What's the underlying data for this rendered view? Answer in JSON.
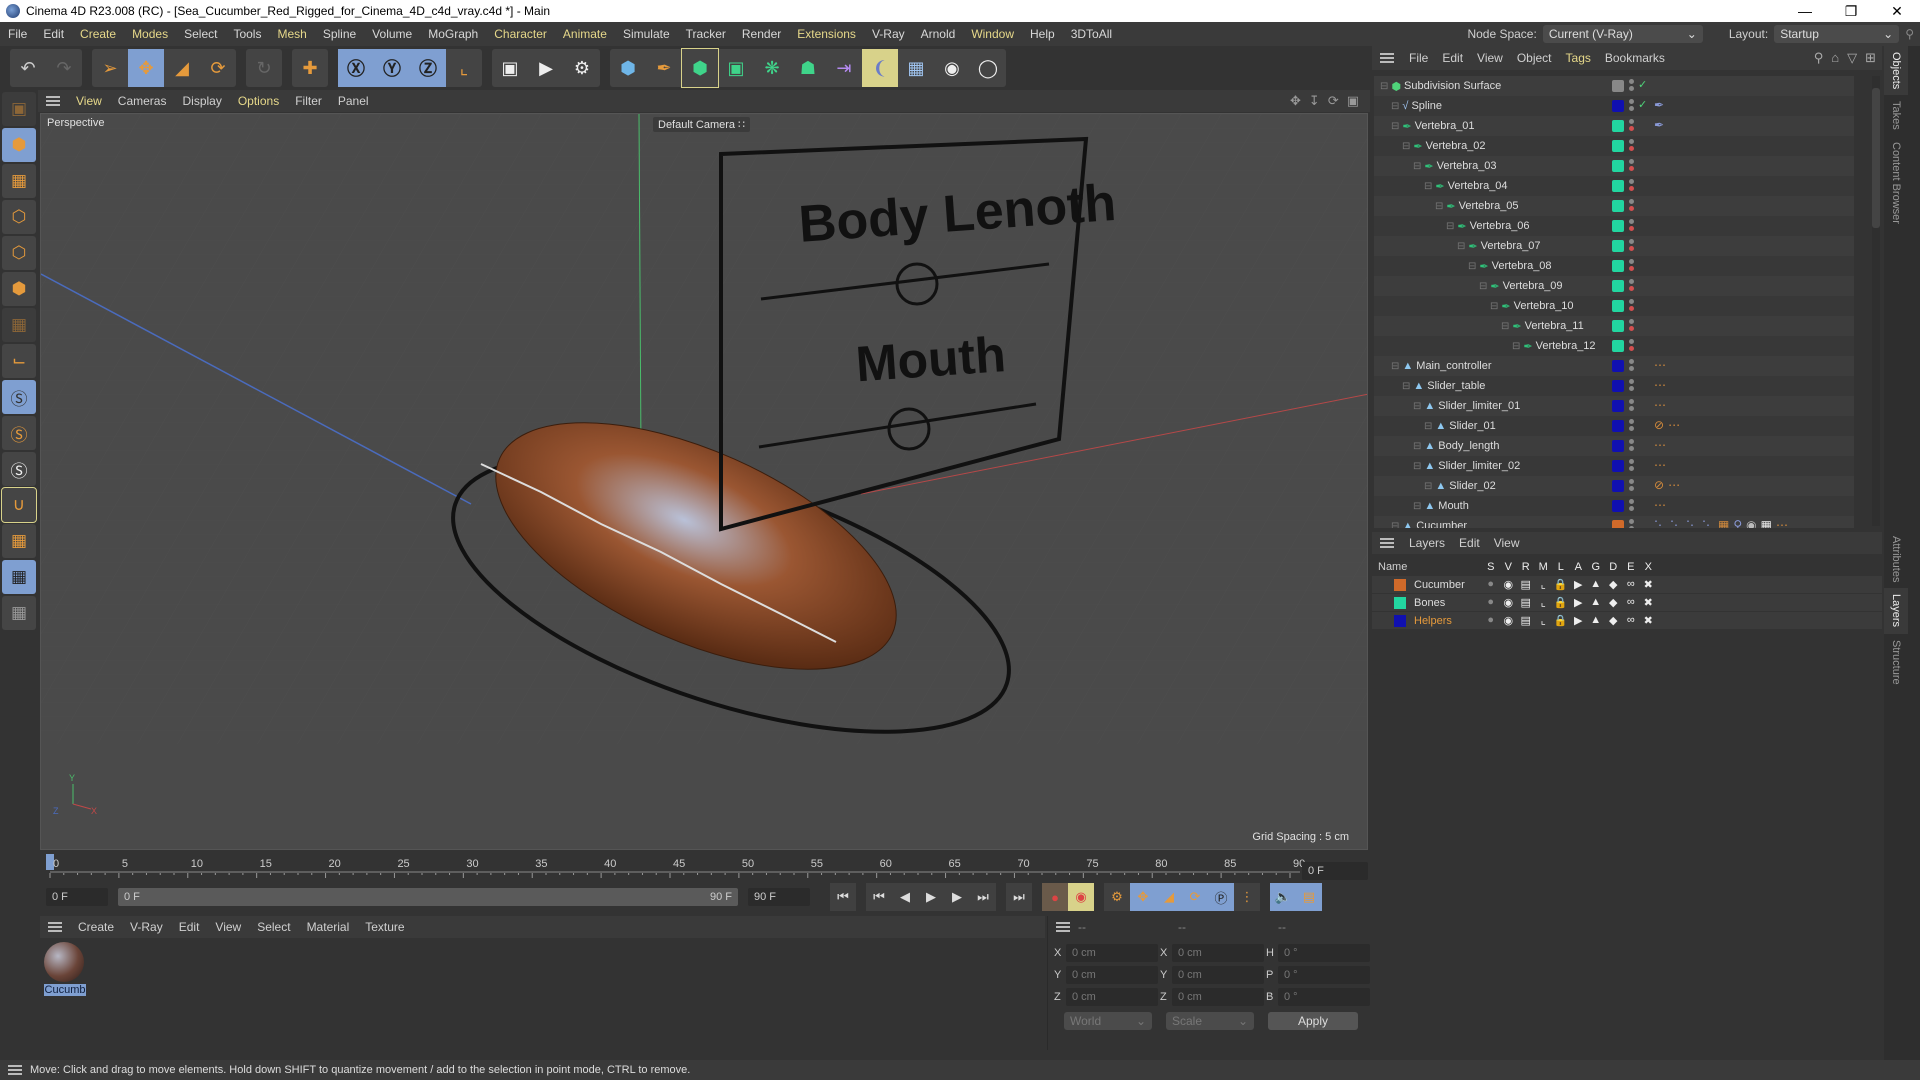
{
  "window": {
    "title": "Cinema 4D R23.008 (RC) - [Sea_Cucumber_Red_Rigged_for_Cinema_4D_c4d_vray.c4d *] - Main",
    "controls": [
      "minimize",
      "restore",
      "close"
    ]
  },
  "menubar": {
    "items": [
      "File",
      "Edit",
      "Create",
      "Modes",
      "Select",
      "Tools",
      "Mesh",
      "Spline",
      "Volume",
      "MoGraph",
      "Character",
      "Animate",
      "Simulate",
      "Tracker",
      "Render",
      "Extensions",
      "V-Ray",
      "Arnold",
      "Window",
      "Help",
      "3DToAll"
    ],
    "highlighted": [
      "Create",
      "Modes",
      "Mesh",
      "Character",
      "Animate",
      "Extensions",
      "Window"
    ],
    "node_space_label": "Node Space:",
    "node_space_value": "Current (V-Ray)",
    "layout_label": "Layout:",
    "layout_value": "Startup"
  },
  "toolbar": {
    "groups": [
      [
        "undo",
        "redo"
      ],
      [
        "select-tool",
        "move-tool",
        "scale-tool",
        "rotate-tool"
      ],
      [
        "psr-lock"
      ],
      [
        "add-tool"
      ],
      [
        "x-axis-lock",
        "y-axis-lock",
        "z-axis-lock",
        "coordinate-system"
      ],
      [
        "render-view",
        "render-picture-viewer",
        "render-settings"
      ],
      [
        "cube",
        "pen-spline",
        "subdivision-surface",
        "extrude",
        "mograph-cloner",
        "array",
        "symmetry",
        "deformer",
        "floor",
        "camera",
        "light"
      ]
    ]
  },
  "left_tools": [
    "make-editable",
    "model-mode",
    "texture-mode",
    "point-mode",
    "edge-mode",
    "polygon-mode",
    "uvw-mode",
    "axis-mode",
    "snap-solo",
    "snap-solo-selection",
    "solo-off",
    "enable-snap",
    "workplane",
    "locked-workplane",
    "workplane-align"
  ],
  "viewport": {
    "menu": [
      "View",
      "Cameras",
      "Display",
      "Options",
      "Filter",
      "Panel"
    ],
    "highlighted": [
      "View",
      "Options"
    ],
    "view_name": "Perspective",
    "camera": "Default Camera",
    "grid_spacing": "Grid Spacing : 5 cm",
    "scene_text": [
      "Body Lenoth",
      "Mouth"
    ]
  },
  "timeline": {
    "ticks": [
      "0",
      "5",
      "10",
      "15",
      "20",
      "25",
      "30",
      "35",
      "40",
      "45",
      "50",
      "55",
      "60",
      "65",
      "70",
      "75",
      "80",
      "85",
      "90"
    ],
    "current_frame_field": "0 F",
    "start_field": "0 F",
    "range_start": "0 F",
    "range_end": "90 F",
    "end_field": "90 F"
  },
  "material_manager": {
    "menu": [
      "Create",
      "V-Ray",
      "Edit",
      "View",
      "Select",
      "Material",
      "Texture"
    ],
    "materials": [
      {
        "name": "Cucumb"
      }
    ]
  },
  "coordinates": {
    "headers": [
      "--",
      "--",
      "--"
    ],
    "rows": [
      {
        "a": "X",
        "v1": "0 cm",
        "b": "X",
        "v2": "0 cm",
        "c": "H",
        "v3": "0 °"
      },
      {
        "a": "Y",
        "v1": "0 cm",
        "b": "Y",
        "v2": "0 cm",
        "c": "P",
        "v3": "0 °"
      },
      {
        "a": "Z",
        "v1": "0 cm",
        "b": "Z",
        "v2": "0 cm",
        "c": "B",
        "v3": "0 °"
      }
    ],
    "space": "World",
    "mode": "Scale",
    "apply": "Apply"
  },
  "objects_panel": {
    "menu": [
      "File",
      "Edit",
      "View",
      "Object",
      "Tags",
      "Bookmarks"
    ],
    "highlighted": [
      "Tags"
    ],
    "items": [
      {
        "name": "Subdivision Surface",
        "depth": 0,
        "type": "subdiv",
        "color": "#888888",
        "check": true
      },
      {
        "name": "Spline",
        "depth": 1,
        "type": "spline",
        "color": "#1010b0",
        "check": true,
        "tags": [
          "ik-spline"
        ]
      },
      {
        "name": "Vertebra_01",
        "depth": 1,
        "type": "bone",
        "color": "#22d6a0",
        "tags": [
          "ik-spline"
        ]
      },
      {
        "name": "Vertebra_02",
        "depth": 2,
        "type": "bone",
        "color": "#22d6a0"
      },
      {
        "name": "Vertebra_03",
        "depth": 3,
        "type": "bone",
        "color": "#22d6a0"
      },
      {
        "name": "Vertebra_04",
        "depth": 4,
        "type": "bone",
        "color": "#22d6a0"
      },
      {
        "name": "Vertebra_05",
        "depth": 5,
        "type": "bone",
        "color": "#22d6a0"
      },
      {
        "name": "Vertebra_06",
        "depth": 6,
        "type": "bone",
        "color": "#22d6a0"
      },
      {
        "name": "Vertebra_07",
        "depth": 7,
        "type": "bone",
        "color": "#22d6a0"
      },
      {
        "name": "Vertebra_08",
        "depth": 8,
        "type": "bone",
        "color": "#22d6a0"
      },
      {
        "name": "Vertebra_09",
        "depth": 9,
        "type": "bone",
        "color": "#22d6a0"
      },
      {
        "name": "Vertebra_10",
        "depth": 10,
        "type": "bone",
        "color": "#22d6a0"
      },
      {
        "name": "Vertebra_11",
        "depth": 11,
        "type": "bone",
        "color": "#22d6a0"
      },
      {
        "name": "Vertebra_12",
        "depth": 12,
        "type": "bone",
        "color": "#22d6a0"
      },
      {
        "name": "Main_controller",
        "depth": 1,
        "type": "null",
        "color": "#1010b0",
        "tags": [
          "constraint"
        ]
      },
      {
        "name": "Slider_table",
        "depth": 2,
        "type": "null",
        "color": "#1010b0",
        "tags": [
          "constraint"
        ]
      },
      {
        "name": "Slider_limiter_01",
        "depth": 3,
        "type": "null",
        "color": "#1010b0",
        "tags": [
          "constraint"
        ]
      },
      {
        "name": "Slider_01",
        "depth": 4,
        "type": "null",
        "color": "#1010b0",
        "tags": [
          "protection",
          "constraint"
        ]
      },
      {
        "name": "Body_length",
        "depth": 3,
        "type": "null",
        "color": "#1010b0",
        "tags": [
          "constraint"
        ]
      },
      {
        "name": "Slider_limiter_02",
        "depth": 3,
        "type": "null",
        "color": "#1010b0",
        "tags": [
          "constraint"
        ]
      },
      {
        "name": "Slider_02",
        "depth": 4,
        "type": "null",
        "color": "#1010b0",
        "tags": [
          "protection",
          "constraint"
        ]
      },
      {
        "name": "Mouth",
        "depth": 3,
        "type": "null",
        "color": "#1010b0",
        "tags": [
          "constraint"
        ]
      },
      {
        "name": "Cucumber",
        "depth": 1,
        "type": "null",
        "color": "#d06a2a",
        "tags": [
          "weight",
          "weight",
          "weight",
          "weight",
          "skin",
          "pose",
          "material",
          "texture",
          "constraint"
        ]
      }
    ]
  },
  "layers_panel": {
    "menu": [
      "Layers",
      "Edit",
      "View"
    ],
    "columns": [
      "Name",
      "S",
      "V",
      "R",
      "M",
      "L",
      "A",
      "G",
      "D",
      "E",
      "X"
    ],
    "layers": [
      {
        "name": "Cucumber",
        "color": "#d06a2a",
        "selected": false
      },
      {
        "name": "Bones",
        "color": "#22d6a0",
        "selected": false
      },
      {
        "name": "Helpers",
        "color": "#1010b0",
        "selected": true
      }
    ]
  },
  "side_tabs": {
    "top": [
      "Objects",
      "Takes",
      "Content Browser"
    ],
    "bottom": [
      "Attributes",
      "Layers",
      "Structure"
    ]
  },
  "statusbar": {
    "text": "Move: Click and drag to move elements. Hold down SHIFT to quantize movement / add to the selection in point mode, CTRL to remove."
  }
}
